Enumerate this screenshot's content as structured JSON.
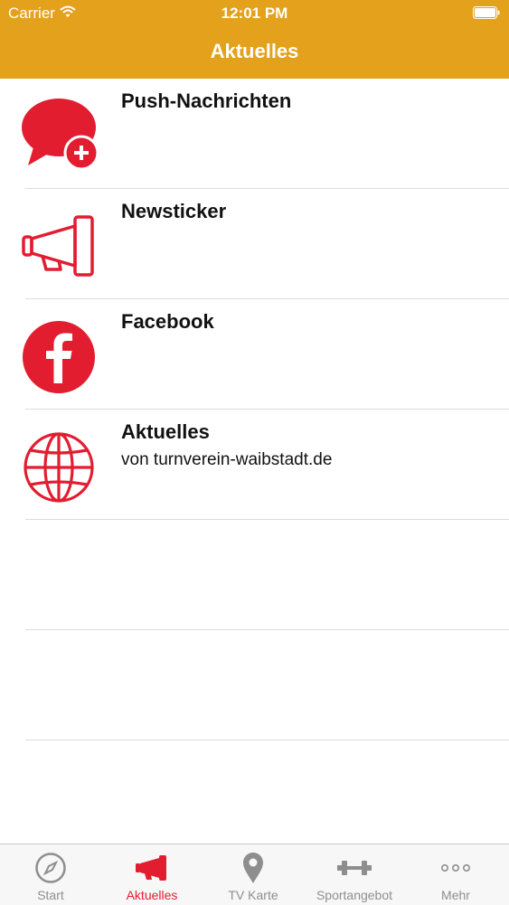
{
  "status_bar": {
    "carrier": "Carrier",
    "time": "12:01 PM"
  },
  "nav": {
    "title": "Aktuelles"
  },
  "list": {
    "items": [
      {
        "title": "Push-Nachrichten",
        "subtitle": "",
        "icon": "chat-plus-icon"
      },
      {
        "title": "Newsticker",
        "subtitle": "",
        "icon": "megaphone-icon"
      },
      {
        "title": "Facebook",
        "subtitle": "",
        "icon": "facebook-icon"
      },
      {
        "title": "Aktuelles",
        "subtitle": "von turnverein-waibstadt.de",
        "icon": "globe-icon"
      }
    ]
  },
  "tabbar": {
    "tabs": [
      {
        "label": "Start",
        "icon": "compass-icon",
        "active": false
      },
      {
        "label": "Aktuelles",
        "icon": "megaphone-icon",
        "active": true
      },
      {
        "label": "TV Karte",
        "icon": "map-pin-icon",
        "active": false
      },
      {
        "label": "Sportangebot",
        "icon": "dumbbell-icon",
        "active": false
      },
      {
        "label": "Mehr",
        "icon": "more-dots-icon",
        "active": false
      }
    ]
  },
  "colors": {
    "header": "#e4a11b",
    "accent": "#e21d30",
    "inactive_tab": "#8e8e8e",
    "separator": "#dcdcdc"
  }
}
